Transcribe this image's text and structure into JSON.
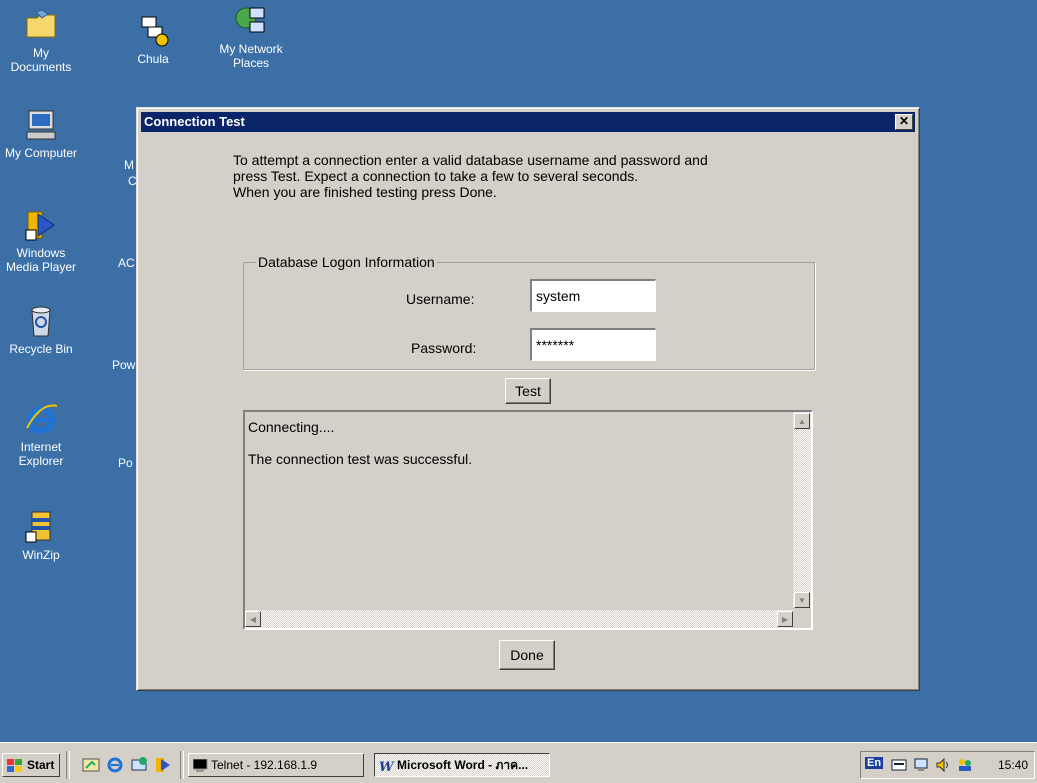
{
  "desktop": {
    "icons": [
      {
        "label": "My Documents"
      },
      {
        "label": "Chula"
      },
      {
        "label": "My Network Places"
      },
      {
        "label": "My Computer"
      },
      {
        "label": "Windows Media Player"
      },
      {
        "label": "Recycle Bin"
      },
      {
        "label": "Internet Explorer"
      },
      {
        "label": "WinZip"
      }
    ],
    "partial_labels": [
      "M",
      "C",
      "AC",
      "Pow",
      "Po"
    ]
  },
  "dialog": {
    "title": "Connection Test",
    "close_glyph": "✕",
    "intro": [
      "To attempt a connection enter a valid database username and password and",
      "press Test.  Expect a connection to take a few to several seconds.",
      "When you are finished testing press Done."
    ],
    "group_title": "Database Logon Information",
    "username_label": "Username:",
    "username_value": "system",
    "password_label": "Password:",
    "password_value": "*******",
    "test_button": "Test",
    "output": [
      "Connecting....",
      "The connection test was successful."
    ],
    "done_button": "Done"
  },
  "taskbar": {
    "start": "Start",
    "tasks": [
      {
        "label": "Telnet - 192.168.1.9",
        "active": false
      },
      {
        "label": "Microsoft Word - ภาค...",
        "active": true
      }
    ],
    "tray_lang": "En",
    "clock": "15:40"
  },
  "colors": {
    "desktop": "#3b6fa6",
    "titlebar": "#0a246a",
    "face": "#d4d0c8"
  }
}
